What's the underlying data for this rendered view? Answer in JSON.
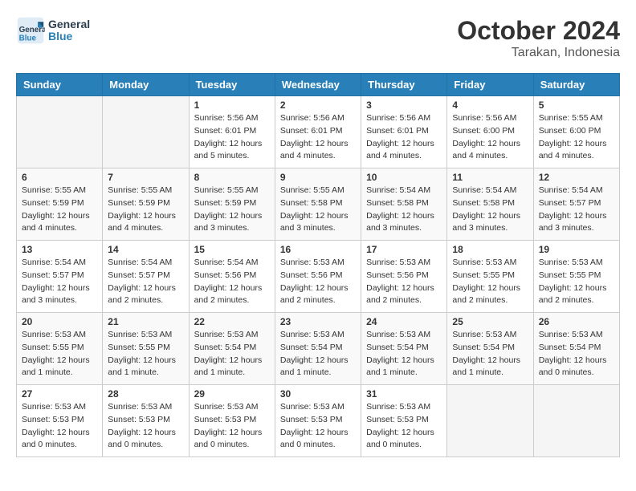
{
  "header": {
    "logo": "GeneralBlue",
    "month_year": "October 2024",
    "location": "Tarakan, Indonesia"
  },
  "days_of_week": [
    "Sunday",
    "Monday",
    "Tuesday",
    "Wednesday",
    "Thursday",
    "Friday",
    "Saturday"
  ],
  "weeks": [
    [
      {
        "day": "",
        "sunrise": "",
        "sunset": "",
        "daylight": ""
      },
      {
        "day": "",
        "sunrise": "",
        "sunset": "",
        "daylight": ""
      },
      {
        "day": "1",
        "sunrise": "Sunrise: 5:56 AM",
        "sunset": "Sunset: 6:01 PM",
        "daylight": "Daylight: 12 hours and 5 minutes."
      },
      {
        "day": "2",
        "sunrise": "Sunrise: 5:56 AM",
        "sunset": "Sunset: 6:01 PM",
        "daylight": "Daylight: 12 hours and 4 minutes."
      },
      {
        "day": "3",
        "sunrise": "Sunrise: 5:56 AM",
        "sunset": "Sunset: 6:01 PM",
        "daylight": "Daylight: 12 hours and 4 minutes."
      },
      {
        "day": "4",
        "sunrise": "Sunrise: 5:56 AM",
        "sunset": "Sunset: 6:00 PM",
        "daylight": "Daylight: 12 hours and 4 minutes."
      },
      {
        "day": "5",
        "sunrise": "Sunrise: 5:55 AM",
        "sunset": "Sunset: 6:00 PM",
        "daylight": "Daylight: 12 hours and 4 minutes."
      }
    ],
    [
      {
        "day": "6",
        "sunrise": "Sunrise: 5:55 AM",
        "sunset": "Sunset: 5:59 PM",
        "daylight": "Daylight: 12 hours and 4 minutes."
      },
      {
        "day": "7",
        "sunrise": "Sunrise: 5:55 AM",
        "sunset": "Sunset: 5:59 PM",
        "daylight": "Daylight: 12 hours and 4 minutes."
      },
      {
        "day": "8",
        "sunrise": "Sunrise: 5:55 AM",
        "sunset": "Sunset: 5:59 PM",
        "daylight": "Daylight: 12 hours and 3 minutes."
      },
      {
        "day": "9",
        "sunrise": "Sunrise: 5:55 AM",
        "sunset": "Sunset: 5:58 PM",
        "daylight": "Daylight: 12 hours and 3 minutes."
      },
      {
        "day": "10",
        "sunrise": "Sunrise: 5:54 AM",
        "sunset": "Sunset: 5:58 PM",
        "daylight": "Daylight: 12 hours and 3 minutes."
      },
      {
        "day": "11",
        "sunrise": "Sunrise: 5:54 AM",
        "sunset": "Sunset: 5:58 PM",
        "daylight": "Daylight: 12 hours and 3 minutes."
      },
      {
        "day": "12",
        "sunrise": "Sunrise: 5:54 AM",
        "sunset": "Sunset: 5:57 PM",
        "daylight": "Daylight: 12 hours and 3 minutes."
      }
    ],
    [
      {
        "day": "13",
        "sunrise": "Sunrise: 5:54 AM",
        "sunset": "Sunset: 5:57 PM",
        "daylight": "Daylight: 12 hours and 3 minutes."
      },
      {
        "day": "14",
        "sunrise": "Sunrise: 5:54 AM",
        "sunset": "Sunset: 5:57 PM",
        "daylight": "Daylight: 12 hours and 2 minutes."
      },
      {
        "day": "15",
        "sunrise": "Sunrise: 5:54 AM",
        "sunset": "Sunset: 5:56 PM",
        "daylight": "Daylight: 12 hours and 2 minutes."
      },
      {
        "day": "16",
        "sunrise": "Sunrise: 5:53 AM",
        "sunset": "Sunset: 5:56 PM",
        "daylight": "Daylight: 12 hours and 2 minutes."
      },
      {
        "day": "17",
        "sunrise": "Sunrise: 5:53 AM",
        "sunset": "Sunset: 5:56 PM",
        "daylight": "Daylight: 12 hours and 2 minutes."
      },
      {
        "day": "18",
        "sunrise": "Sunrise: 5:53 AM",
        "sunset": "Sunset: 5:55 PM",
        "daylight": "Daylight: 12 hours and 2 minutes."
      },
      {
        "day": "19",
        "sunrise": "Sunrise: 5:53 AM",
        "sunset": "Sunset: 5:55 PM",
        "daylight": "Daylight: 12 hours and 2 minutes."
      }
    ],
    [
      {
        "day": "20",
        "sunrise": "Sunrise: 5:53 AM",
        "sunset": "Sunset: 5:55 PM",
        "daylight": "Daylight: 12 hours and 1 minute."
      },
      {
        "day": "21",
        "sunrise": "Sunrise: 5:53 AM",
        "sunset": "Sunset: 5:55 PM",
        "daylight": "Daylight: 12 hours and 1 minute."
      },
      {
        "day": "22",
        "sunrise": "Sunrise: 5:53 AM",
        "sunset": "Sunset: 5:54 PM",
        "daylight": "Daylight: 12 hours and 1 minute."
      },
      {
        "day": "23",
        "sunrise": "Sunrise: 5:53 AM",
        "sunset": "Sunset: 5:54 PM",
        "daylight": "Daylight: 12 hours and 1 minute."
      },
      {
        "day": "24",
        "sunrise": "Sunrise: 5:53 AM",
        "sunset": "Sunset: 5:54 PM",
        "daylight": "Daylight: 12 hours and 1 minute."
      },
      {
        "day": "25",
        "sunrise": "Sunrise: 5:53 AM",
        "sunset": "Sunset: 5:54 PM",
        "daylight": "Daylight: 12 hours and 1 minute."
      },
      {
        "day": "26",
        "sunrise": "Sunrise: 5:53 AM",
        "sunset": "Sunset: 5:54 PM",
        "daylight": "Daylight: 12 hours and 0 minutes."
      }
    ],
    [
      {
        "day": "27",
        "sunrise": "Sunrise: 5:53 AM",
        "sunset": "Sunset: 5:53 PM",
        "daylight": "Daylight: 12 hours and 0 minutes."
      },
      {
        "day": "28",
        "sunrise": "Sunrise: 5:53 AM",
        "sunset": "Sunset: 5:53 PM",
        "daylight": "Daylight: 12 hours and 0 minutes."
      },
      {
        "day": "29",
        "sunrise": "Sunrise: 5:53 AM",
        "sunset": "Sunset: 5:53 PM",
        "daylight": "Daylight: 12 hours and 0 minutes."
      },
      {
        "day": "30",
        "sunrise": "Sunrise: 5:53 AM",
        "sunset": "Sunset: 5:53 PM",
        "daylight": "Daylight: 12 hours and 0 minutes."
      },
      {
        "day": "31",
        "sunrise": "Sunrise: 5:53 AM",
        "sunset": "Sunset: 5:53 PM",
        "daylight": "Daylight: 12 hours and 0 minutes."
      },
      {
        "day": "",
        "sunrise": "",
        "sunset": "",
        "daylight": ""
      },
      {
        "day": "",
        "sunrise": "",
        "sunset": "",
        "daylight": ""
      }
    ]
  ]
}
